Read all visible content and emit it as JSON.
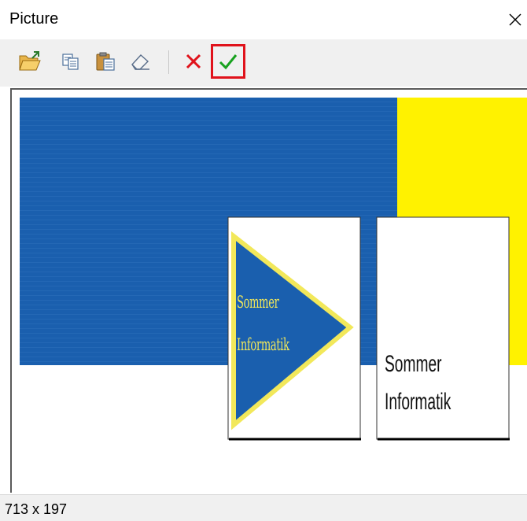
{
  "window": {
    "title": "Picture",
    "close_icon": "close-icon"
  },
  "toolbar": {
    "buttons": [
      {
        "name": "open-button",
        "icon": "folder-open-icon"
      },
      {
        "name": "copy-button",
        "icon": "copy-icon"
      },
      {
        "name": "paste-button",
        "icon": "paste-icon"
      },
      {
        "name": "clear-button",
        "icon": "eraser-icon"
      },
      {
        "name": "cancel-button",
        "icon": "red-x-icon"
      },
      {
        "name": "ok-button",
        "icon": "green-check-icon",
        "highlighted": true
      }
    ]
  },
  "picture": {
    "colors": {
      "blue": "#1a5fae",
      "yellow": "#fff200",
      "white": "#ffffff"
    },
    "logo_left": {
      "line1": "Sommer",
      "line2": "Informatik"
    },
    "logo_right": {
      "line1": "Sommer",
      "line2": "Informatik"
    }
  },
  "status": {
    "dimensions": "713 x 197"
  },
  "colors": {
    "highlight": "#e0121b",
    "toolbar_bg": "#f0f0f0"
  }
}
